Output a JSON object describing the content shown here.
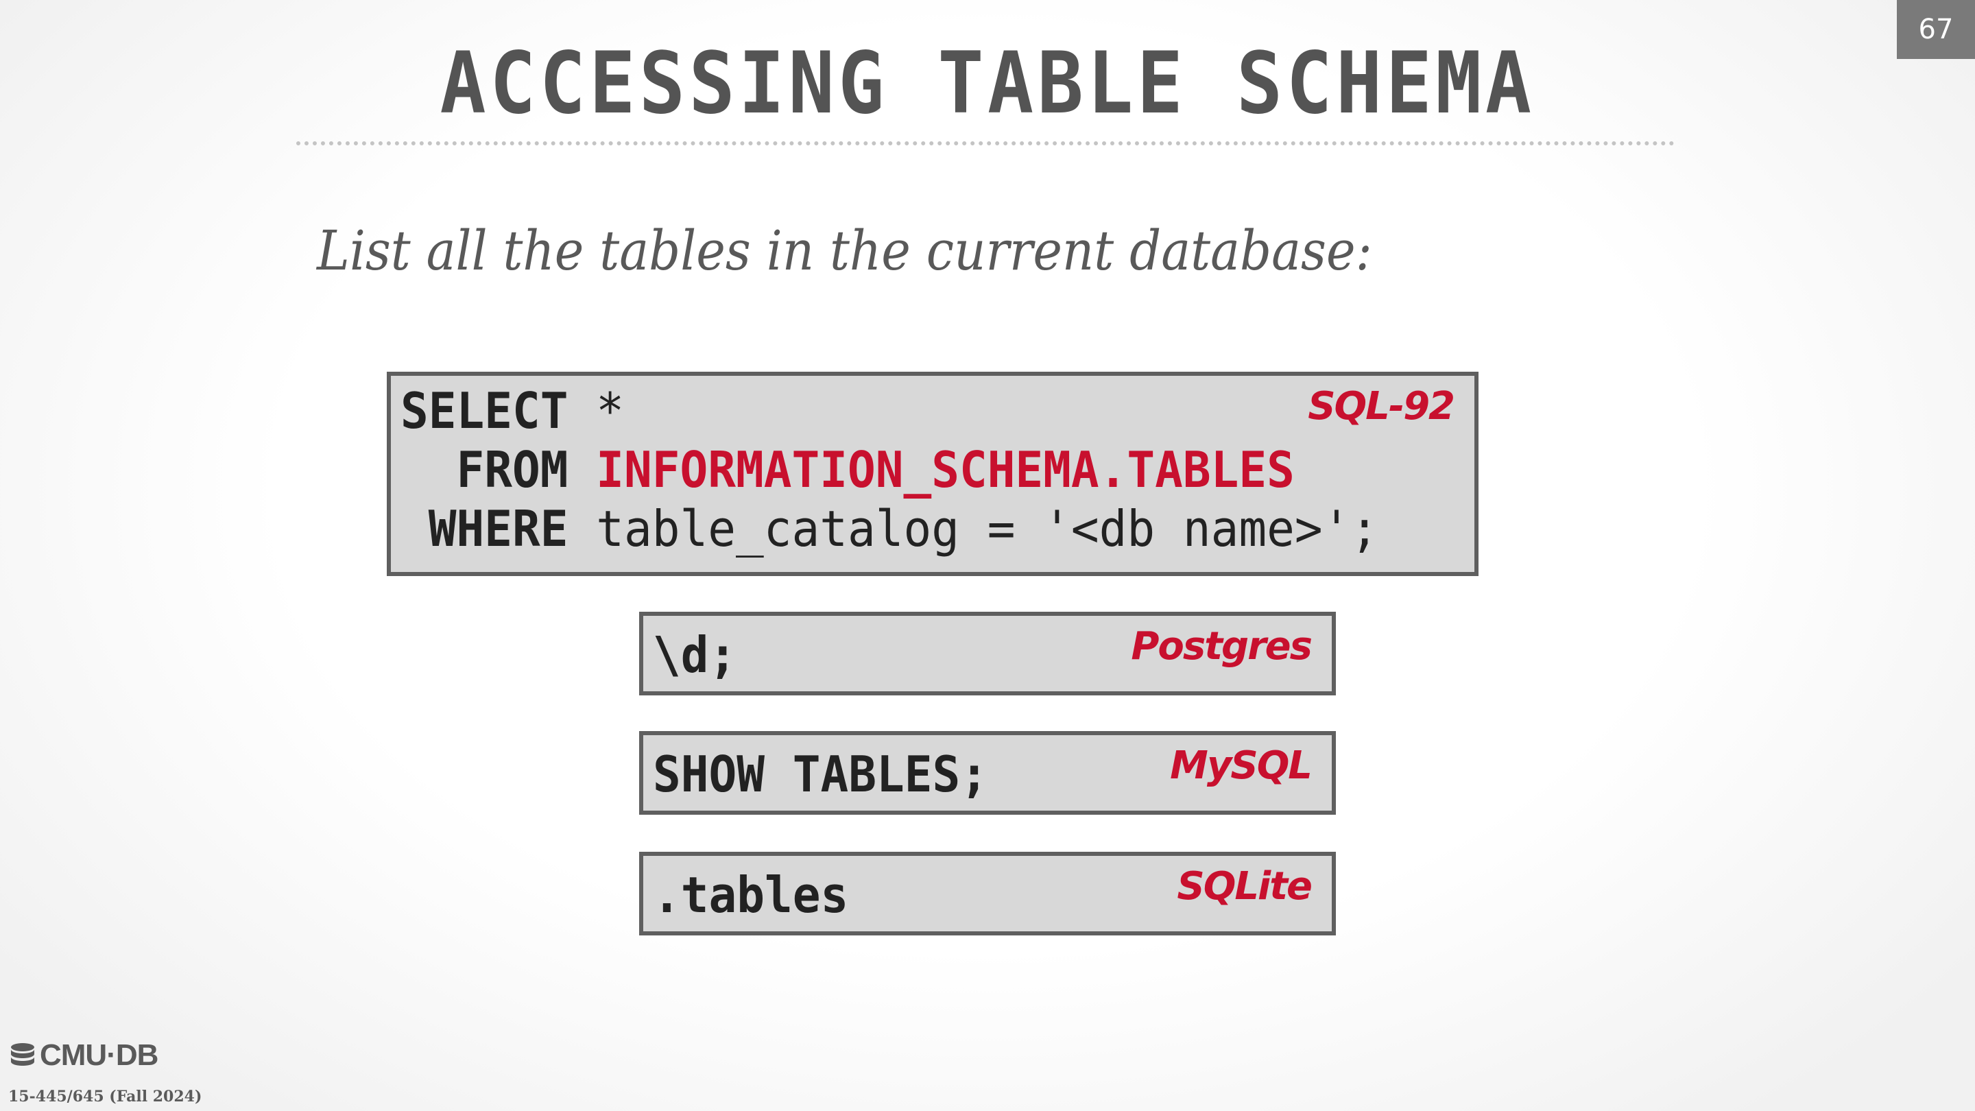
{
  "slide_number": "67",
  "title": "ACCESSING TABLE SCHEMA",
  "subtitle": "List all the tables in the current database:",
  "sql92": {
    "tag": "SQL-92",
    "line1_kw": "SELECT",
    "line1_rest": " *",
    "line2_kw": "  FROM",
    "line2_obj": " INFORMATION_SCHEMA.TABLES",
    "line3_kw": " WHERE",
    "line3_rest": " table_catalog = '<db name>';"
  },
  "postgres": {
    "tag": "Postgres",
    "code": "\\d;"
  },
  "mysql": {
    "tag": "MySQL",
    "code": "SHOW TABLES;"
  },
  "sqlite": {
    "tag": "SQLite",
    "code": ".tables"
  },
  "footer": {
    "logo_text": "CMU·DB",
    "logo_icon": "database-icon",
    "course": "15-445/645 (Fall 2024)"
  },
  "colors": {
    "accent": "#c8102e",
    "title": "#545454",
    "code_box_bg": "#d8d8d8",
    "code_box_border": "#5f5f5f",
    "slide_number_bg": "#7a7a7a"
  }
}
